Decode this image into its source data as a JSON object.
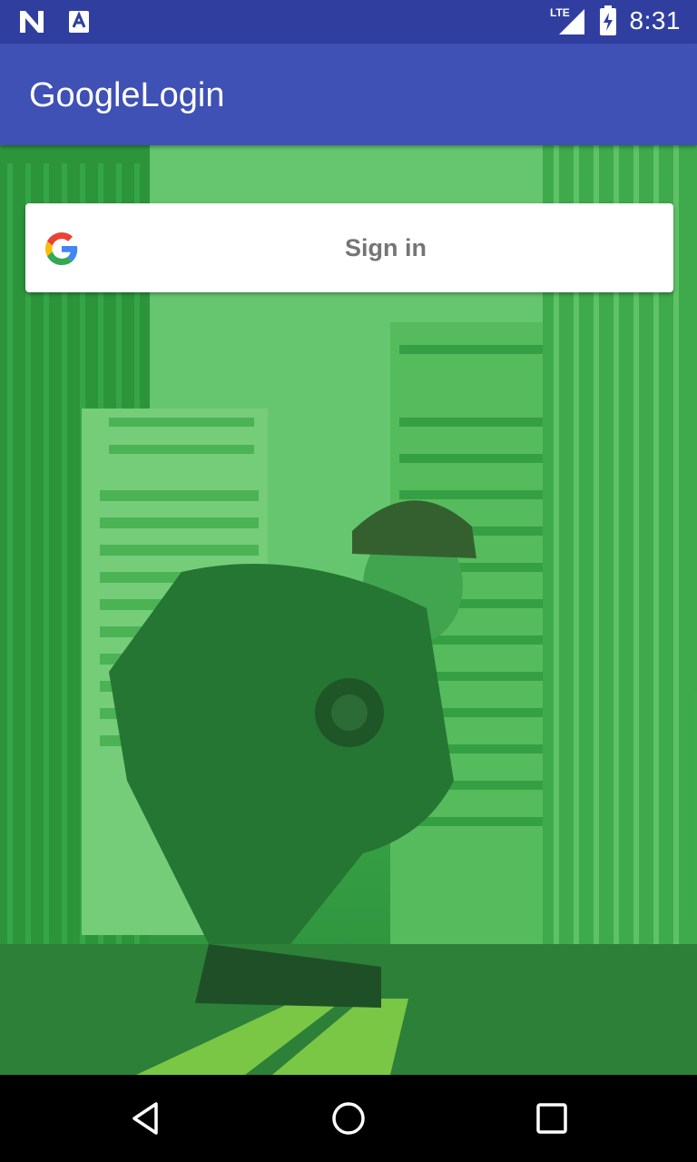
{
  "status_bar": {
    "time": "8:31",
    "network": "LTE",
    "icons": [
      "n-notification-icon",
      "a-notification-icon",
      "lte-signal-icon",
      "battery-charging-icon"
    ]
  },
  "app_bar": {
    "title": "GoogleLogin"
  },
  "signin": {
    "label": "Sign in",
    "icon": "google-g-icon"
  },
  "nav_bar": {
    "icons": [
      "back-icon",
      "home-icon",
      "recents-icon"
    ]
  },
  "colors": {
    "status_bar": "#303F9F",
    "app_bar": "#3F51B5",
    "overlay": "#2AAA3C"
  }
}
